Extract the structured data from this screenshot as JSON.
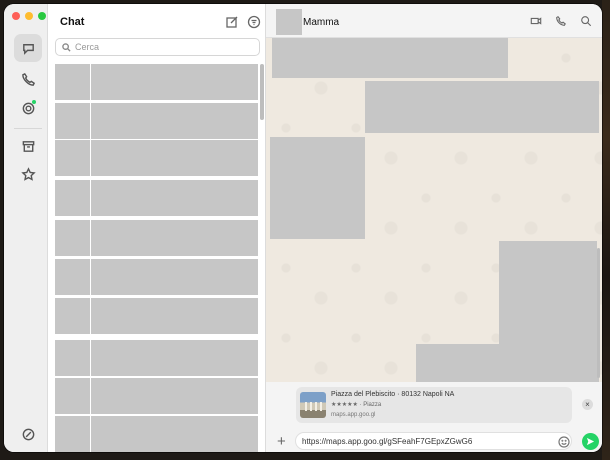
{
  "app": {
    "list_title": "Chat",
    "accent_color": "#25d366"
  },
  "rail": {
    "items": [
      {
        "icon": "chat-icon",
        "active": true
      },
      {
        "icon": "phone-icon"
      },
      {
        "icon": "status-icon"
      },
      {
        "icon": "archive-icon"
      },
      {
        "icon": "star-icon"
      },
      {
        "icon": "settings-icon"
      }
    ]
  },
  "search": {
    "placeholder": "Cerca",
    "value": ""
  },
  "conversation": {
    "name": "Mamma",
    "header_icons": [
      "video-call-icon",
      "phone-icon",
      "search-icon"
    ]
  },
  "composer": {
    "link_preview": {
      "title": "Piazza del Plebiscito · 80132 Napoli NA",
      "subtitle": "★★★★★ · Piazza",
      "url": "maps.app.goo.gl",
      "close": "×"
    },
    "input_value": "https://maps.app.goo.gl/gSFeahF7GEpxZGwG6",
    "plus": "+"
  }
}
